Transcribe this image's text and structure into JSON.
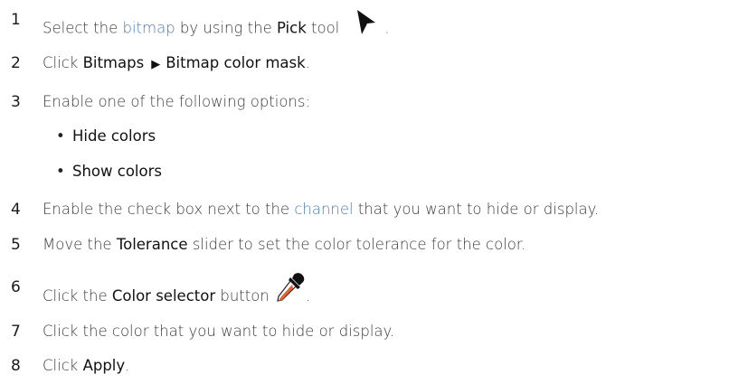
{
  "steps": [
    {
      "num": "1",
      "pre": "Select the ",
      "link": "bitmap",
      "mid": " by using the ",
      "ui": "Pick",
      "post": " tool",
      "end": "."
    },
    {
      "num": "2",
      "pre": "Click ",
      "ui1": "Bitmaps",
      "arrow": "▶",
      "ui2": "Bitmap color mask",
      "end": "."
    },
    {
      "num": "3",
      "text": "Enable one of the following options:",
      "options": [
        {
          "bullet": "•",
          "label": "Hide colors"
        },
        {
          "bullet": "•",
          "label": "Show colors"
        }
      ]
    },
    {
      "num": "4",
      "pre": "Enable the check box next to the ",
      "link": "channel",
      "post": " that you want to hide or display."
    },
    {
      "num": "5",
      "pre": "Move the ",
      "ui": "Tolerance",
      "post": " slider to set the color tolerance for the color."
    },
    {
      "num": "6",
      "pre": "Click the ",
      "ui": "Color selector",
      "post": " button",
      "end": "."
    },
    {
      "num": "7",
      "text": "Click the color that you want to hide or display."
    },
    {
      "num": "8",
      "pre": "Click ",
      "ui": "Apply",
      "end": "."
    }
  ],
  "icons": {
    "pick_tool": "pick-tool-cursor-icon",
    "color_selector": "eyedropper-icon"
  },
  "colors": {
    "link": "#4a7bb0",
    "text": "#3a3a3a",
    "ui_term": "#111111",
    "eyedropper_tip": "#e8622b"
  }
}
